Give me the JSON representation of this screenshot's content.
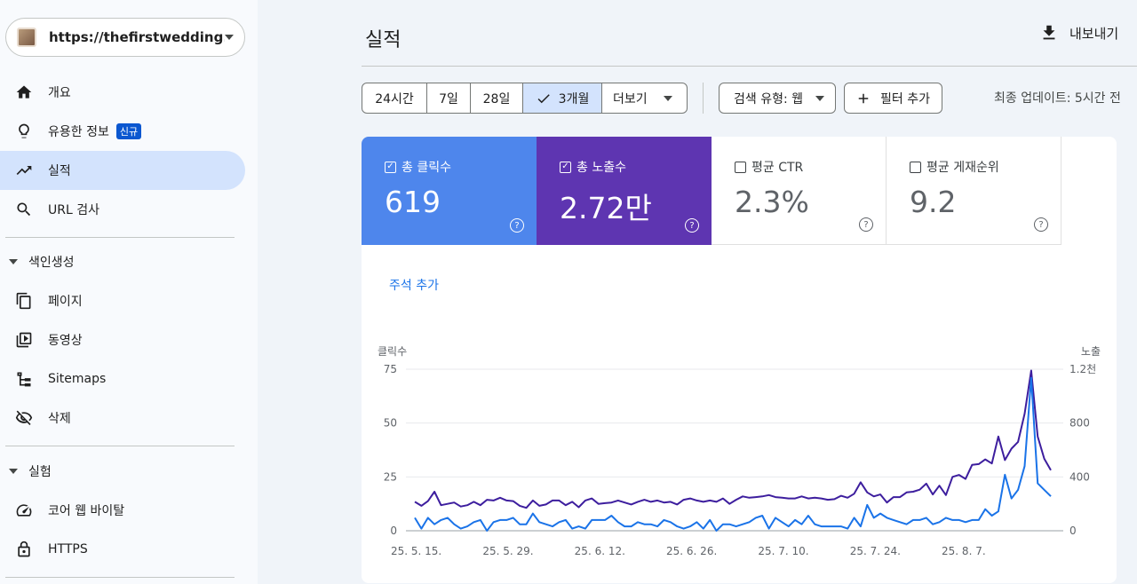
{
  "sidebar": {
    "property": "https://thefirstwedding...",
    "items": [
      {
        "label": "개요",
        "icon": "home-icon"
      },
      {
        "label": "유용한 정보",
        "icon": "lightbulb-icon",
        "badge": "신규"
      },
      {
        "label": "실적",
        "icon": "trending-up-icon",
        "active": true
      },
      {
        "label": "URL 검사",
        "icon": "search-icon"
      }
    ],
    "indexing": {
      "title": "색인생성",
      "items": [
        {
          "label": "페이지",
          "icon": "pages-icon"
        },
        {
          "label": "동영상",
          "icon": "video-icon"
        },
        {
          "label": "Sitemaps",
          "icon": "sitemap-icon"
        },
        {
          "label": "삭제",
          "icon": "visibility-off-icon"
        }
      ]
    },
    "experience": {
      "title": "실험",
      "items": [
        {
          "label": "코어 웹 바이탈",
          "icon": "speed-icon"
        },
        {
          "label": "HTTPS",
          "icon": "lock-icon"
        }
      ]
    }
  },
  "header": {
    "title": "실적",
    "export_label": "내보내기"
  },
  "toolbar": {
    "ranges": [
      "24시간",
      "7일",
      "28일",
      "3개월"
    ],
    "selected_range": "3개월",
    "more_label": "더보기",
    "search_type": "검색 유형: 웹",
    "add_filter": "필터 추가",
    "updated": "최종 업데이트: 5시간 전"
  },
  "metrics": {
    "clicks": {
      "label": "총 클릭수",
      "value": "619",
      "checked": true,
      "color": "#4e86ec"
    },
    "impressions": {
      "label": "총 노출수",
      "value": "2.72만",
      "checked": true,
      "color": "#5e35b1"
    },
    "ctr": {
      "label": "평균 CTR",
      "value": "2.3%",
      "checked": false
    },
    "position": {
      "label": "평균 게재순위",
      "value": "9.2",
      "checked": false
    }
  },
  "annotation_link": "주석 추가",
  "chart_data": {
    "type": "line",
    "left_axis": {
      "label": "클릭수",
      "ticks": [
        "0",
        "25",
        "50",
        "75"
      ],
      "ylim": [
        0,
        75
      ]
    },
    "right_axis": {
      "label": "노출",
      "ticks": [
        "0",
        "400",
        "800",
        "1.2천"
      ],
      "ylim": [
        0,
        1200
      ]
    },
    "x_ticks": [
      "25. 5. 15.",
      "25. 5. 29.",
      "25. 6. 12.",
      "25. 6. 26.",
      "25. 7. 10.",
      "25. 7. 24.",
      "25. 8. 7."
    ],
    "series": [
      {
        "name": "클릭수",
        "axis": "left",
        "color": "#1a73e8",
        "values": [
          6,
          1,
          6,
          3,
          5,
          6,
          3,
          1,
          2,
          4,
          5,
          0,
          4,
          5,
          5,
          6,
          3,
          3,
          8,
          4,
          3,
          2,
          4,
          5,
          1,
          2,
          1,
          5,
          5,
          5,
          7,
          4,
          2,
          2,
          4,
          3,
          3,
          2,
          5,
          4,
          2,
          1,
          2,
          4,
          1,
          5,
          0,
          3,
          3,
          2,
          3,
          4,
          6,
          7,
          1,
          6,
          4,
          2,
          5,
          3,
          7,
          3,
          2,
          2,
          2,
          2,
          1,
          6,
          2,
          12,
          6,
          8,
          6,
          5,
          4,
          3,
          5,
          5,
          6,
          3,
          4,
          6,
          5,
          5,
          4,
          5,
          5,
          10,
          7,
          9,
          26,
          15,
          19,
          30,
          71,
          22,
          19,
          16
        ]
      },
      {
        "name": "노출",
        "axis": "right",
        "color": "#3d1e9e",
        "values": [
          215,
          185,
          220,
          290,
          190,
          200,
          210,
          180,
          190,
          215,
          190,
          230,
          225,
          245,
          225,
          220,
          185,
          170,
          225,
          185,
          195,
          225,
          225,
          190,
          215,
          175,
          225,
          240,
          200,
          205,
          210,
          225,
          210,
          195,
          215,
          230,
          215,
          225,
          210,
          215,
          195,
          230,
          240,
          225,
          215,
          225,
          215,
          240,
          200,
          230,
          255,
          245,
          250,
          255,
          265,
          250,
          245,
          240,
          240,
          255,
          240,
          245,
          240,
          230,
          235,
          260,
          245,
          275,
          360,
          285,
          255,
          270,
          210,
          250,
          250,
          285,
          290,
          305,
          350,
          270,
          335,
          265,
          400,
          415,
          385,
          490,
          495,
          530,
          500,
          700,
          525,
          610,
          660,
          870,
          1190,
          700,
          535,
          450
        ]
      }
    ],
    "legend": "none",
    "grid": true
  }
}
